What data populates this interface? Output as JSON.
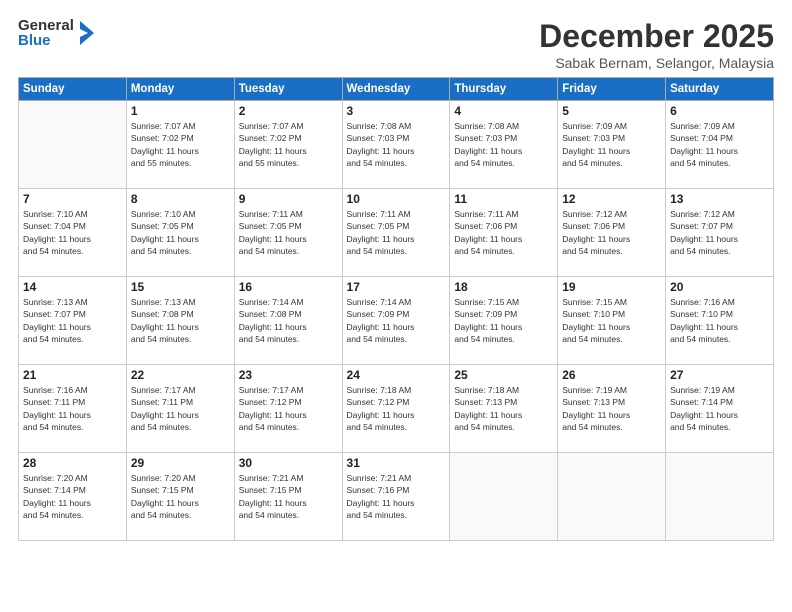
{
  "logo": {
    "general": "General",
    "blue": "Blue"
  },
  "title": "December 2025",
  "location": "Sabak Bernam, Selangor, Malaysia",
  "days_header": [
    "Sunday",
    "Monday",
    "Tuesday",
    "Wednesday",
    "Thursday",
    "Friday",
    "Saturday"
  ],
  "weeks": [
    [
      {
        "day": "",
        "info": ""
      },
      {
        "day": "1",
        "info": "Sunrise: 7:07 AM\nSunset: 7:02 PM\nDaylight: 11 hours\nand 55 minutes."
      },
      {
        "day": "2",
        "info": "Sunrise: 7:07 AM\nSunset: 7:02 PM\nDaylight: 11 hours\nand 55 minutes."
      },
      {
        "day": "3",
        "info": "Sunrise: 7:08 AM\nSunset: 7:03 PM\nDaylight: 11 hours\nand 54 minutes."
      },
      {
        "day": "4",
        "info": "Sunrise: 7:08 AM\nSunset: 7:03 PM\nDaylight: 11 hours\nand 54 minutes."
      },
      {
        "day": "5",
        "info": "Sunrise: 7:09 AM\nSunset: 7:03 PM\nDaylight: 11 hours\nand 54 minutes."
      },
      {
        "day": "6",
        "info": "Sunrise: 7:09 AM\nSunset: 7:04 PM\nDaylight: 11 hours\nand 54 minutes."
      }
    ],
    [
      {
        "day": "7",
        "info": "Sunrise: 7:10 AM\nSunset: 7:04 PM\nDaylight: 11 hours\nand 54 minutes."
      },
      {
        "day": "8",
        "info": "Sunrise: 7:10 AM\nSunset: 7:05 PM\nDaylight: 11 hours\nand 54 minutes."
      },
      {
        "day": "9",
        "info": "Sunrise: 7:11 AM\nSunset: 7:05 PM\nDaylight: 11 hours\nand 54 minutes."
      },
      {
        "day": "10",
        "info": "Sunrise: 7:11 AM\nSunset: 7:05 PM\nDaylight: 11 hours\nand 54 minutes."
      },
      {
        "day": "11",
        "info": "Sunrise: 7:11 AM\nSunset: 7:06 PM\nDaylight: 11 hours\nand 54 minutes."
      },
      {
        "day": "12",
        "info": "Sunrise: 7:12 AM\nSunset: 7:06 PM\nDaylight: 11 hours\nand 54 minutes."
      },
      {
        "day": "13",
        "info": "Sunrise: 7:12 AM\nSunset: 7:07 PM\nDaylight: 11 hours\nand 54 minutes."
      }
    ],
    [
      {
        "day": "14",
        "info": "Sunrise: 7:13 AM\nSunset: 7:07 PM\nDaylight: 11 hours\nand 54 minutes."
      },
      {
        "day": "15",
        "info": "Sunrise: 7:13 AM\nSunset: 7:08 PM\nDaylight: 11 hours\nand 54 minutes."
      },
      {
        "day": "16",
        "info": "Sunrise: 7:14 AM\nSunset: 7:08 PM\nDaylight: 11 hours\nand 54 minutes."
      },
      {
        "day": "17",
        "info": "Sunrise: 7:14 AM\nSunset: 7:09 PM\nDaylight: 11 hours\nand 54 minutes."
      },
      {
        "day": "18",
        "info": "Sunrise: 7:15 AM\nSunset: 7:09 PM\nDaylight: 11 hours\nand 54 minutes."
      },
      {
        "day": "19",
        "info": "Sunrise: 7:15 AM\nSunset: 7:10 PM\nDaylight: 11 hours\nand 54 minutes."
      },
      {
        "day": "20",
        "info": "Sunrise: 7:16 AM\nSunset: 7:10 PM\nDaylight: 11 hours\nand 54 minutes."
      }
    ],
    [
      {
        "day": "21",
        "info": "Sunrise: 7:16 AM\nSunset: 7:11 PM\nDaylight: 11 hours\nand 54 minutes."
      },
      {
        "day": "22",
        "info": "Sunrise: 7:17 AM\nSunset: 7:11 PM\nDaylight: 11 hours\nand 54 minutes."
      },
      {
        "day": "23",
        "info": "Sunrise: 7:17 AM\nSunset: 7:12 PM\nDaylight: 11 hours\nand 54 minutes."
      },
      {
        "day": "24",
        "info": "Sunrise: 7:18 AM\nSunset: 7:12 PM\nDaylight: 11 hours\nand 54 minutes."
      },
      {
        "day": "25",
        "info": "Sunrise: 7:18 AM\nSunset: 7:13 PM\nDaylight: 11 hours\nand 54 minutes."
      },
      {
        "day": "26",
        "info": "Sunrise: 7:19 AM\nSunset: 7:13 PM\nDaylight: 11 hours\nand 54 minutes."
      },
      {
        "day": "27",
        "info": "Sunrise: 7:19 AM\nSunset: 7:14 PM\nDaylight: 11 hours\nand 54 minutes."
      }
    ],
    [
      {
        "day": "28",
        "info": "Sunrise: 7:20 AM\nSunset: 7:14 PM\nDaylight: 11 hours\nand 54 minutes."
      },
      {
        "day": "29",
        "info": "Sunrise: 7:20 AM\nSunset: 7:15 PM\nDaylight: 11 hours\nand 54 minutes."
      },
      {
        "day": "30",
        "info": "Sunrise: 7:21 AM\nSunset: 7:15 PM\nDaylight: 11 hours\nand 54 minutes."
      },
      {
        "day": "31",
        "info": "Sunrise: 7:21 AM\nSunset: 7:16 PM\nDaylight: 11 hours\nand 54 minutes."
      },
      {
        "day": "",
        "info": ""
      },
      {
        "day": "",
        "info": ""
      },
      {
        "day": "",
        "info": ""
      }
    ]
  ]
}
